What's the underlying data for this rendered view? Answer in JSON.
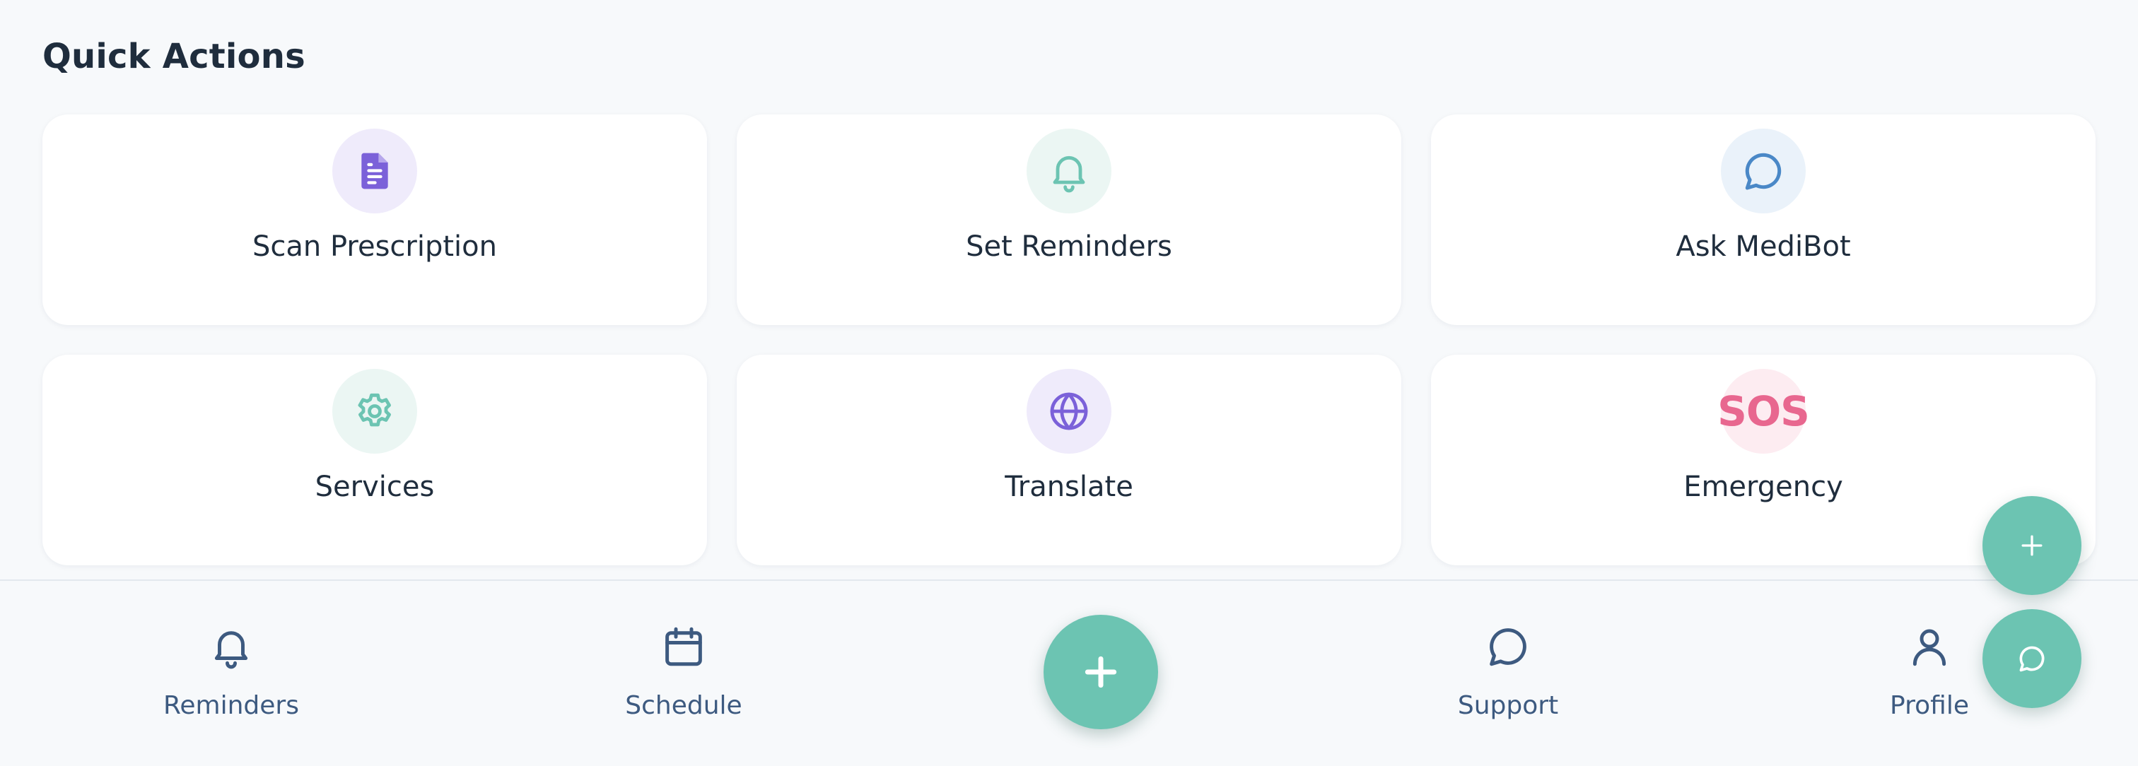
{
  "quick_actions": {
    "title": "Quick Actions",
    "cards": [
      {
        "label": "Scan Prescription",
        "icon": "document-icon",
        "icon_color": "#7b61d9",
        "icon_bg": "#efebfb"
      },
      {
        "label": "Set Reminders",
        "icon": "bell-icon",
        "icon_color": "#6cc4b2",
        "icon_bg": "#ebf6f3"
      },
      {
        "label": "Ask MediBot",
        "icon": "chat-bubble-icon",
        "icon_color": "#4a88c7",
        "icon_bg": "#eaf2fa"
      },
      {
        "label": "Services",
        "icon": "gear-icon",
        "icon_color": "#6cc4b2",
        "icon_bg": "#ebf6f3"
      },
      {
        "label": "Translate",
        "icon": "globe-icon",
        "icon_color": "#7b61d9",
        "icon_bg": "#efebfb"
      },
      {
        "label": "Emergency",
        "icon": "sos-icon",
        "icon_text": "SOS",
        "icon_color": "#e8678f",
        "icon_bg": "#fdecf1"
      }
    ]
  },
  "bottom_nav": {
    "items": [
      {
        "label": "Reminders",
        "icon": "bell-icon"
      },
      {
        "label": "Schedule",
        "icon": "calendar-icon"
      },
      {
        "label": "Support",
        "icon": "chat-bubble-icon"
      },
      {
        "label": "Profile",
        "icon": "user-icon"
      }
    ],
    "center_button": {
      "icon": "plus-icon"
    },
    "nav_color": "#3d5a80"
  },
  "floating_buttons": [
    {
      "icon": "plus-icon"
    },
    {
      "icon": "chat-bubble-icon"
    }
  ],
  "colors": {
    "accent": "#6cc4b2",
    "background": "#f7f9fb",
    "card": "#ffffff",
    "text": "#1f2d3d"
  }
}
